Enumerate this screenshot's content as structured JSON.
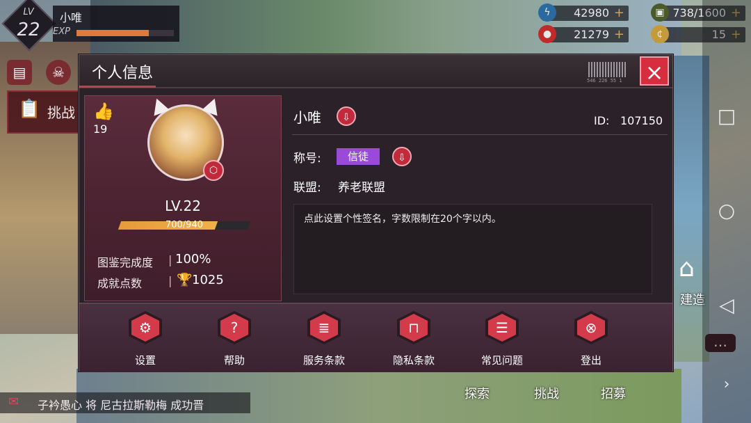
{
  "player": {
    "lv_label": "LV",
    "level": "22",
    "name": "小唯",
    "exp_label": "EXP",
    "exp_progress": 0.74
  },
  "resources": [
    {
      "icon": "energy-icon",
      "value": "42980",
      "plus": "+"
    },
    {
      "icon": "stamina-icon",
      "value": "738/1600",
      "plus": "+"
    },
    {
      "icon": "ruby-icon",
      "value": "21279",
      "plus": "+"
    },
    {
      "icon": "coin-icon",
      "value": "15",
      "plus": "+"
    }
  ],
  "side": {
    "challenge_label": "挑战"
  },
  "background": {
    "build_label": "建造",
    "explore_label": "探索",
    "challenge_label": "挑战",
    "recruit_label": "招募",
    "ticker_text": "子衿愚心 将 尼古拉斯勒梅 成功晋"
  },
  "modal": {
    "title": "个人信息",
    "barcode_text": "546 226 55 1",
    "close_icon": "×",
    "card": {
      "like_count": "19",
      "level_text": "LV.22",
      "exp_text": "700/940",
      "exp_progress": 0.745,
      "stats": [
        {
          "label": "图鉴完成度",
          "sep": "|",
          "value": "100%"
        },
        {
          "label": "成就点数",
          "sep": "|",
          "value": "1025"
        }
      ]
    },
    "nickname": "小唯",
    "id_label": "ID:",
    "id_value": "107150",
    "title_label": "称号:",
    "title_value": "信徒",
    "guild_label": "联盟:",
    "guild_value": "养老联盟",
    "signature": "点此设置个性签名，字数限制在20个字以内。",
    "footer": [
      {
        "label": "设置",
        "icon": "gear-icon",
        "glyph": "⚙"
      },
      {
        "label": "帮助",
        "icon": "help-icon",
        "glyph": "?"
      },
      {
        "label": "服务条款",
        "icon": "terms-icon",
        "glyph": "≣"
      },
      {
        "label": "隐私条款",
        "icon": "lock-icon",
        "glyph": "⊓"
      },
      {
        "label": "常见问题",
        "icon": "faq-icon",
        "glyph": "☰"
      },
      {
        "label": "登出",
        "icon": "logout-icon",
        "glyph": "⊗"
      }
    ]
  },
  "colors": {
    "accent_red": "#d33a4a",
    "panel": "#2a2228",
    "title_chip": "#9a4ad8",
    "exp_orange": "#e89a3a"
  }
}
